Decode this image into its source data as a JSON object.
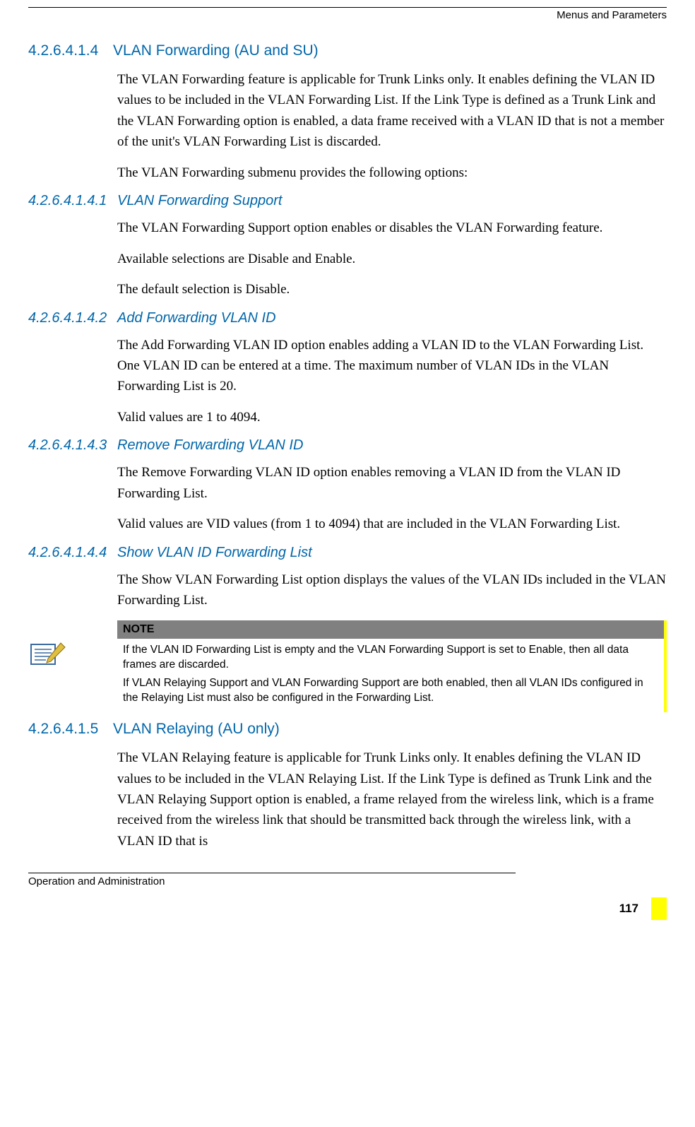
{
  "header": {
    "right": "Menus and Parameters"
  },
  "sections": [
    {
      "level": "h2",
      "num": "4.2.6.4.1.4",
      "title": "VLAN Forwarding (AU and SU)",
      "paras": [
        "The VLAN Forwarding feature is applicable for Trunk Links only. It enables defining the VLAN ID values to be included in the VLAN Forwarding List. If the Link Type is defined as a Trunk Link and the VLAN Forwarding option is enabled, a data frame received with a VLAN ID that is not a member of the unit's VLAN Forwarding List is discarded.",
        "The VLAN Forwarding submenu provides the following options:"
      ]
    },
    {
      "level": "h3",
      "num": "4.2.6.4.1.4.1",
      "title": "VLAN Forwarding Support",
      "paras": [
        "The VLAN Forwarding Support option enables or disables the VLAN Forwarding feature.",
        "Available selections are Disable and Enable.",
        "The default selection is Disable."
      ]
    },
    {
      "level": "h3",
      "num": "4.2.6.4.1.4.2",
      "title": "Add Forwarding VLAN ID",
      "paras": [
        "The Add Forwarding VLAN ID option enables adding a VLAN ID to the VLAN Forwarding List. One VLAN ID can be entered at a time. The maximum number of VLAN IDs in the VLAN Forwarding List is 20.",
        "Valid values are 1 to 4094."
      ]
    },
    {
      "level": "h3",
      "num": "4.2.6.4.1.4.3",
      "title": "Remove Forwarding VLAN ID",
      "paras": [
        "The Remove Forwarding VLAN ID option enables removing a VLAN ID from the VLAN ID Forwarding List.",
        "Valid values are VID values (from 1 to 4094) that are included in the VLAN Forwarding List."
      ]
    },
    {
      "level": "h3",
      "num": "4.2.6.4.1.4.4",
      "title": "Show VLAN ID Forwarding List",
      "paras": [
        "The Show VLAN Forwarding List option displays the values of the VLAN IDs included in the VLAN Forwarding List."
      ]
    }
  ],
  "note": {
    "label": "NOTE",
    "paras": [
      "If the VLAN ID Forwarding List is empty and the VLAN Forwarding Support is set to Enable, then all data frames are discarded.",
      "If VLAN Relaying Support and VLAN Forwarding Support are both enabled, then all VLAN IDs configured in the Relaying List must also be configured in the Forwarding List."
    ]
  },
  "section_after_note": {
    "level": "h2",
    "num": "4.2.6.4.1.5",
    "title": "VLAN Relaying (AU only)",
    "paras": [
      "The VLAN Relaying feature is applicable for Trunk Links only. It enables defining the VLAN ID values to be included in the VLAN Relaying List. If the Link Type is defined as Trunk Link and the VLAN Relaying Support option is enabled, a frame relayed from the wireless link, which is a frame received from the wireless link that should be transmitted back through the wireless link, with a VLAN ID that is"
    ]
  },
  "footer": {
    "left": "Operation and Administration",
    "page": "117"
  }
}
